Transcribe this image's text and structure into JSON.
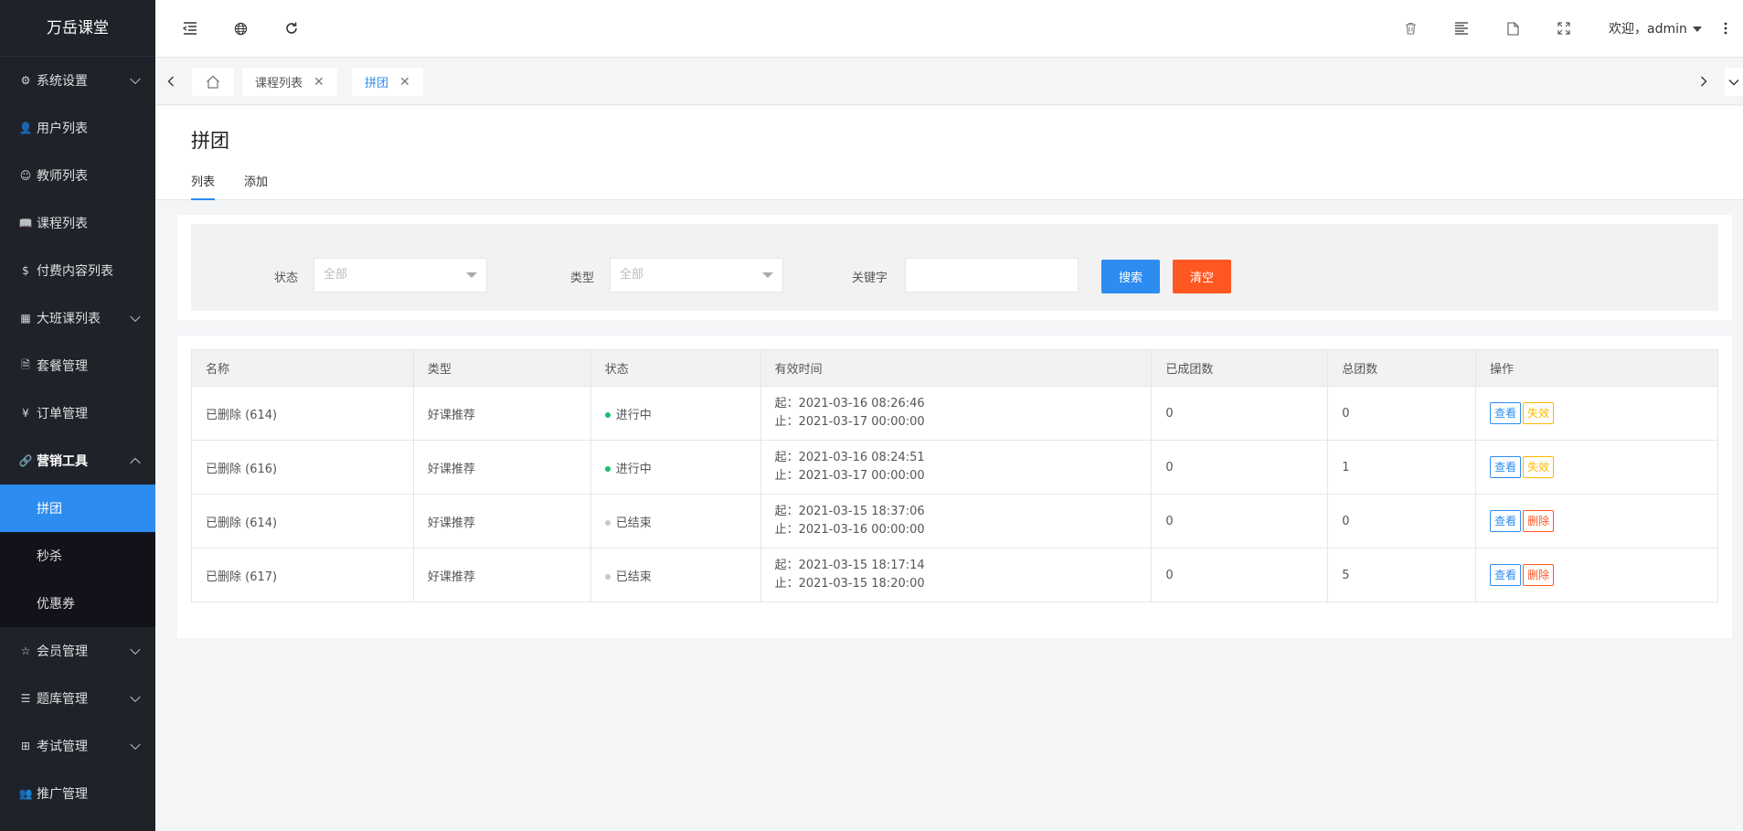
{
  "app": {
    "logo": "万岳课堂"
  },
  "sidebar": {
    "items": [
      {
        "label": "系统设置",
        "icon": "gear-icon",
        "glyph": "⚙",
        "arrow": "down"
      },
      {
        "label": "用户列表",
        "icon": "user-icon",
        "glyph": "👤",
        "arrow": ""
      },
      {
        "label": "教师列表",
        "icon": "teacher-icon",
        "glyph": "☺",
        "arrow": ""
      },
      {
        "label": "课程列表",
        "icon": "book-icon",
        "glyph": "📖",
        "arrow": ""
      },
      {
        "label": "付费内容列表",
        "icon": "dollar-icon",
        "glyph": "$",
        "arrow": ""
      },
      {
        "label": "大班课列表",
        "icon": "grid-icon",
        "glyph": "▦",
        "arrow": "down"
      },
      {
        "label": "套餐管理",
        "icon": "document-icon",
        "glyph": "🗎",
        "arrow": ""
      },
      {
        "label": "订单管理",
        "icon": "yen-icon",
        "glyph": "¥",
        "arrow": ""
      },
      {
        "label": "营销工具",
        "icon": "link-icon",
        "glyph": "🔗",
        "arrow": "up"
      },
      {
        "label": "会员管理",
        "icon": "star-icon",
        "glyph": "☆",
        "arrow": "down"
      },
      {
        "label": "题库管理",
        "icon": "list-icon",
        "glyph": "☰",
        "arrow": "down"
      },
      {
        "label": "考试管理",
        "icon": "apps-icon",
        "glyph": "⊞",
        "arrow": "down"
      },
      {
        "label": "推广管理",
        "icon": "users-icon",
        "glyph": "👥",
        "arrow": ""
      }
    ],
    "submenu": [
      {
        "label": "拼团",
        "active": true
      },
      {
        "label": "秒杀",
        "active": false
      },
      {
        "label": "优惠券",
        "active": false
      }
    ]
  },
  "header": {
    "welcome": "欢迎，admin",
    "icons": [
      "menu-collapse-icon",
      "globe-icon",
      "refresh-icon",
      "trash-icon",
      "text-align-icon",
      "file-icon",
      "fullscreen-icon",
      "more-icon"
    ]
  },
  "tabs": {
    "items": [
      {
        "label": "课程列表",
        "active": false
      },
      {
        "label": "拼团",
        "active": true
      }
    ]
  },
  "page": {
    "title": "拼团",
    "subtabs": [
      "列表",
      "添加"
    ]
  },
  "filter": {
    "status_label": "状态",
    "status_value": "全部",
    "type_label": "类型",
    "type_value": "全部",
    "keyword_label": "关键字",
    "keyword_value": "",
    "search_label": "搜索",
    "clear_label": "清空"
  },
  "table": {
    "headers": [
      "名称",
      "类型",
      "状态",
      "有效时间",
      "已成团数",
      "总团数",
      "操作"
    ],
    "view_label": "查看",
    "rows": [
      {
        "name": "已删除 (614)",
        "type": "好课推荐",
        "status": "进行中",
        "status_color": "#19be6b",
        "start": "起：2021-03-16 08:26:46",
        "end": "止：2021-03-17 00:00:00",
        "formed": "0",
        "total": "0",
        "action2": "失效",
        "action2_kind": "invalid"
      },
      {
        "name": "已删除 (616)",
        "type": "好课推荐",
        "status": "进行中",
        "status_color": "#19be6b",
        "start": "起：2021-03-16 08:24:51",
        "end": "止：2021-03-17 00:00:00",
        "formed": "0",
        "total": "1",
        "action2": "失效",
        "action2_kind": "invalid"
      },
      {
        "name": "已删除 (614)",
        "type": "好课推荐",
        "status": "已结束",
        "status_color": "#c5c8ce",
        "start": "起：2021-03-15 18:37:06",
        "end": "止：2021-03-16 00:00:00",
        "formed": "0",
        "total": "0",
        "action2": "删除",
        "action2_kind": "delete"
      },
      {
        "name": "已删除 (617)",
        "type": "好课推荐",
        "status": "已结束",
        "status_color": "#c5c8ce",
        "start": "起：2021-03-15 18:17:14",
        "end": "止：2021-03-15 18:20:00",
        "formed": "0",
        "total": "5",
        "action2": "删除",
        "action2_kind": "delete"
      }
    ]
  },
  "colors": {
    "accent": "#2d8cf0",
    "danger": "#ff5722",
    "warning": "#ffb800",
    "sidebar_bg": "#20222a"
  }
}
